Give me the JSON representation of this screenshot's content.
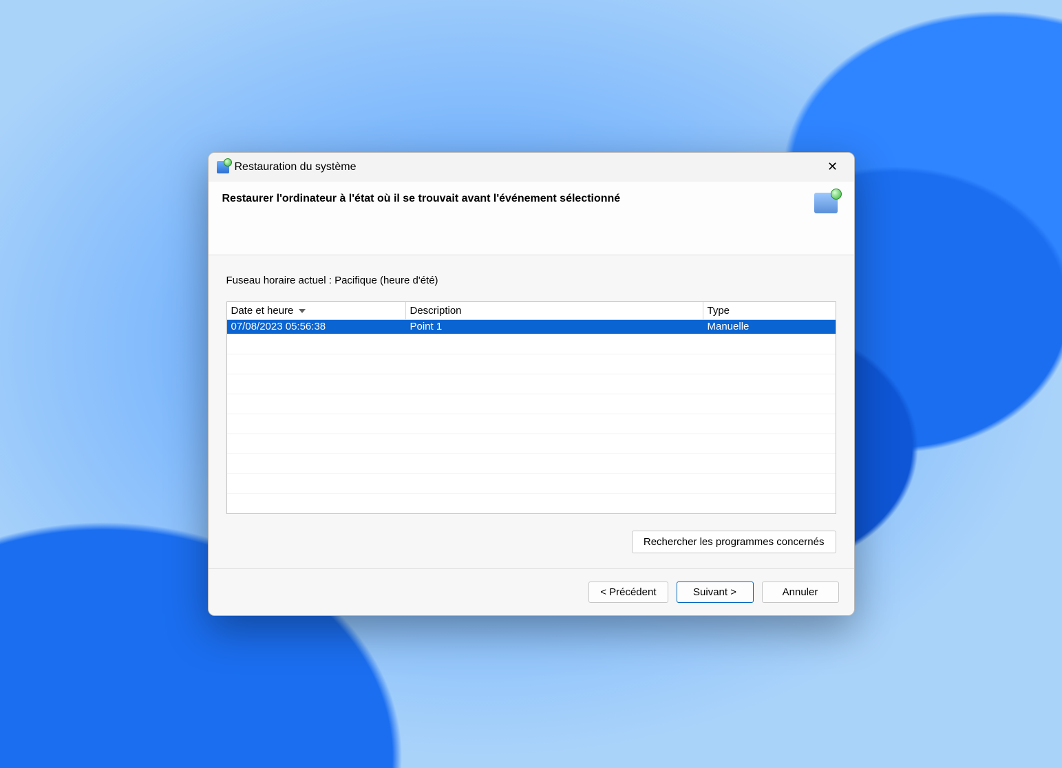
{
  "window": {
    "title": "Restauration du système"
  },
  "header": {
    "title": "Restaurer l'ordinateur à l'état où il se trouvait avant l'événement sélectionné"
  },
  "timezone_line": "Fuseau horaire actuel : Pacifique (heure d'été)",
  "table": {
    "columns": {
      "date": "Date et heure",
      "description": "Description",
      "type": "Type"
    },
    "rows": [
      {
        "date": "07/08/2023 05:56:38",
        "description": "Point 1",
        "type": "Manuelle"
      }
    ]
  },
  "buttons": {
    "scan": "Rechercher les programmes concernés",
    "back": "< Précédent",
    "next": "Suivant >",
    "cancel": "Annuler"
  }
}
